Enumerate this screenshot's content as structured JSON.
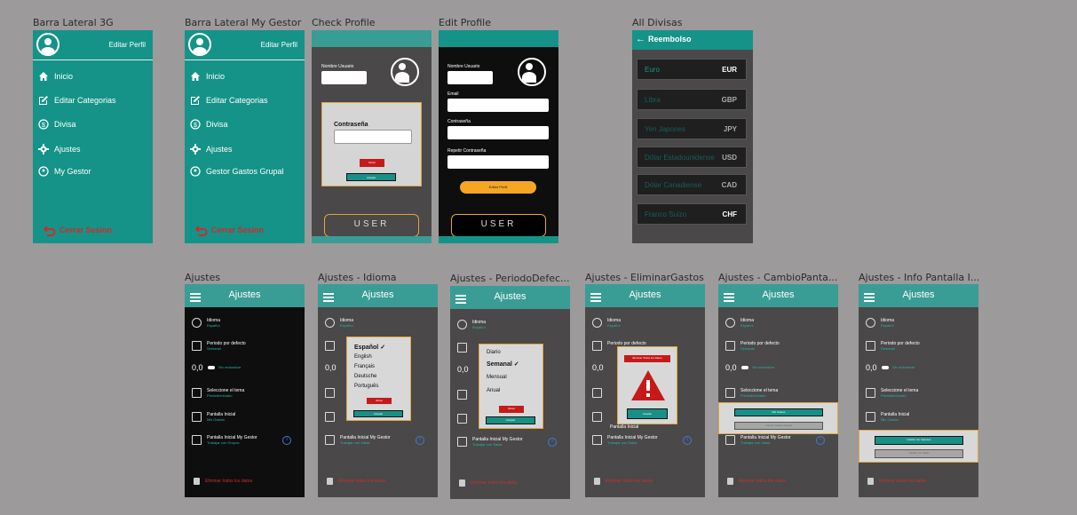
{
  "frames": {
    "sidebar3g": "Barra Lateral 3G",
    "sidebarMyGestor": "Barra Lateral My Gestor",
    "checkProfile": "Check Profile",
    "editProfile": "Edit Profile",
    "allDivisas": "All Divisas",
    "ajustes": "Ajustes",
    "ajustesIdioma": "Ajustes - Idioma",
    "ajustesPeriodo": "Ajustes - PeriodoDefec...",
    "ajustesEliminar": "Ajustes - EliminarGastos",
    "ajustesCambio": "Ajustes - CambioPanta...",
    "ajustesInfo": "Ajustes - Info Pantalla I..."
  },
  "sidebar": {
    "edit_profile": "Editar Perfil",
    "items3g": [
      "Inicio",
      "Editar Categorias",
      "Divisa",
      "Ajustes",
      "My Gestor"
    ],
    "itemsMy": [
      "Inicio",
      "Editar Categorias",
      "Divisa",
      "Ajustes",
      "Gestor Gastos Grupal"
    ],
    "logout": "Cerrar Sesion"
  },
  "profile": {
    "username_label": "Nombre Usuario",
    "password_label": "Contraseña",
    "back": "Volver",
    "accept": "Aceptar",
    "email_label": "Email",
    "password_small": "Contraseña",
    "repeat_password": "Repetir Contraseña",
    "edit_button": "Editar Perfil",
    "user": "USER"
  },
  "divisas": {
    "title": "Reembolso",
    "items": [
      {
        "name": "Euro",
        "code": "EUR"
      },
      {
        "name": "Libra",
        "code": "GBP"
      },
      {
        "name": "Yen Japones",
        "code": "JPY"
      },
      {
        "name": "Dólar Estadounidense",
        "code": "USD"
      },
      {
        "name": "Dólar Canadiense",
        "code": "CAD"
      },
      {
        "name": "Franco Suizo",
        "code": "CHF"
      }
    ]
  },
  "settings": {
    "title": "Ajustes",
    "idioma": "Idioma",
    "idioma_val": "Español",
    "periodo": "Periodo por defecto",
    "periodo_val": "Semanal",
    "decimal": "0,0",
    "decimal_val": "Sin redondear",
    "tema": "Seleccione el tema",
    "tema_val": "Predeterminado",
    "pantalla": "Pantalla Inicial",
    "pantalla_val": "Mis Gastos",
    "pantalla_my": "Pantalla Inicial My Gestor",
    "pantalla_my_val": "Trabajar con Grupos",
    "pantalla_my_val2": "Trabajar con Salas",
    "delete": "Eliminar todos los datos"
  },
  "idioma_popup": {
    "options": [
      "Español",
      "English",
      "Français",
      "Deutsche",
      "Português"
    ],
    "back": "Volver",
    "accept": "Aceptar"
  },
  "periodo_popup": {
    "options": [
      "Diario",
      "Semanal",
      "Mensual",
      "Anual"
    ],
    "back": "Volver",
    "accept": "Aceptar"
  },
  "eliminar_popup": {
    "title": "Eliminar Todos los Datos",
    "accept": "Aceptar",
    "pantalla_label": "Pantalla Inicial"
  },
  "cambio_popup": {
    "opt1": "Mis Gastos",
    "opt2": "Gestor Gastos Grupal"
  },
  "info_popup": {
    "opt1": "Gastar con Ingresos",
    "opt2": "Gastar con Salas"
  },
  "colors": {
    "teal": "#159388",
    "header": "#3a9d95",
    "orange": "#f5a623",
    "red": "#c61a1a"
  }
}
